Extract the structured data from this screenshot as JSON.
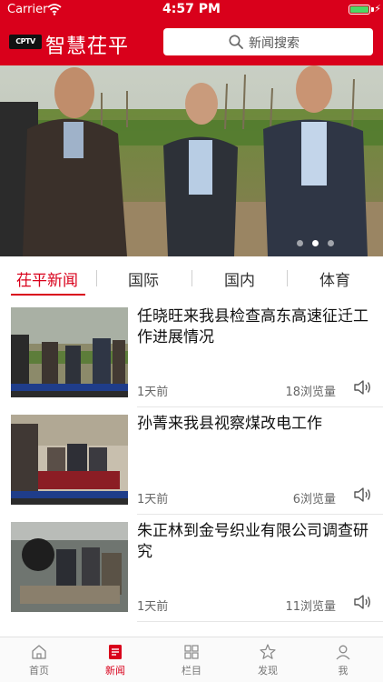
{
  "status_bar": {
    "carrier": "Carrier",
    "time": "4:57 PM",
    "battery_level": 1.0
  },
  "header": {
    "logo_text": "CPTV",
    "app_title": "智慧茌平",
    "search_placeholder": "新闻搜索"
  },
  "banner": {
    "slide_count": 3,
    "active_slide": 2
  },
  "tabs": [
    {
      "label": "茌平新闻",
      "active": true
    },
    {
      "label": "国际",
      "active": false
    },
    {
      "label": "国内",
      "active": false
    },
    {
      "label": "体育",
      "active": false
    }
  ],
  "news": [
    {
      "title": "任晓旺来我县检查高东高速征迁工作进展情况",
      "time": "1天前",
      "views": "18浏览量"
    },
    {
      "title": "孙菁来我县视察煤改电工作",
      "time": "1天前",
      "views": "6浏览量"
    },
    {
      "title": "朱正林到金号织业有限公司调查研究",
      "time": "1天前",
      "views": "11浏览量"
    }
  ],
  "tabbar": [
    {
      "label": "首页",
      "icon": "home-icon",
      "active": false
    },
    {
      "label": "新闻",
      "icon": "news-icon",
      "active": true
    },
    {
      "label": "栏目",
      "icon": "grid-icon",
      "active": false
    },
    {
      "label": "发现",
      "icon": "discover-icon",
      "active": false
    },
    {
      "label": "我",
      "icon": "user-icon",
      "active": false
    }
  ],
  "colors": {
    "brand_red": "#d9001b",
    "text_dark": "#111111",
    "text_muted": "#666666"
  }
}
